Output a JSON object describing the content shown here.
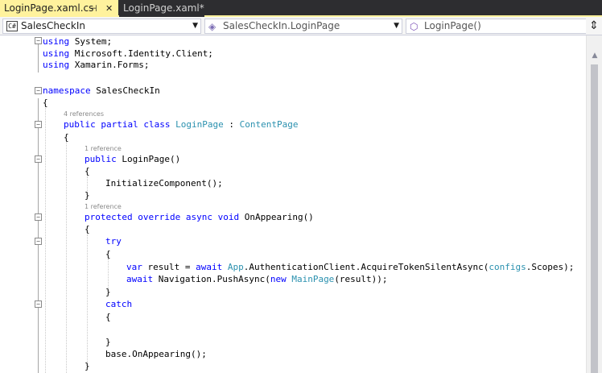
{
  "tabs": [
    {
      "label": "LoginPage.xaml.cs",
      "active": true,
      "pin_icon": "pin-icon",
      "close_icon": "close-icon"
    },
    {
      "label": "LoginPage.xaml*",
      "active": false
    }
  ],
  "navbar": {
    "project": {
      "icon": "csharp-project-icon",
      "icon_text": "C#",
      "label": "SalesCheckIn"
    },
    "type": {
      "icon": "class-icon",
      "label": "SalesCheckIn.LoginPage"
    },
    "member": {
      "icon": "method-icon",
      "label": "LoginPage()"
    }
  },
  "code": {
    "l1": {
      "kw": "using",
      "rest": " System;"
    },
    "l2": {
      "kw": "using",
      "rest": " Microsoft.Identity.Client;"
    },
    "l3": {
      "kw": "using",
      "rest": " Xamarin.Forms;"
    },
    "l5": {
      "kw": "namespace",
      "rest": " SalesCheckIn"
    },
    "l6": {
      "text": "{"
    },
    "lens1": "4 references",
    "l7": {
      "kw1": "public",
      "sp1": " ",
      "kw2": "partial",
      "sp2": " ",
      "kw3": "class",
      "sp3": " ",
      "type": "LoginPage",
      "sep": " : ",
      "base": "ContentPage"
    },
    "l8": {
      "text": "{"
    },
    "lens2": "1 reference",
    "l9": {
      "kw": "public",
      "rest": " LoginPage()"
    },
    "l10": {
      "text": "{"
    },
    "l11": {
      "text": "InitializeComponent();"
    },
    "l12": {
      "text": "}"
    },
    "lens3": "1 reference",
    "l13": {
      "kw1": "protected",
      "sp1": " ",
      "kw2": "override",
      "sp2": " ",
      "kw3": "async",
      "sp3": " ",
      "kw4": "void",
      "rest": " OnAppearing()"
    },
    "l14": {
      "text": "{"
    },
    "l15": {
      "kw": "try"
    },
    "l16": {
      "text": "{"
    },
    "l17": {
      "kw1": "var",
      "p1": " result = ",
      "kw2": "await",
      "sp": " ",
      "type1": "App",
      "p2": ".AuthenticationClient.AcquireTokenSilentAsync(",
      "type2": "configs",
      "p3": ".Scopes);"
    },
    "l18": {
      "kw1": "await",
      "p1": " Navigation.PushAsync(",
      "kw2": "new",
      "sp": " ",
      "type": "MainPage",
      "p2": "(result));"
    },
    "l19": {
      "text": "}"
    },
    "l20": {
      "kw": "catch"
    },
    "l21": {
      "text": "{"
    },
    "l22": {
      "text": ""
    },
    "l23": {
      "text": "}"
    },
    "l24": {
      "text": "base.OnAppearing();"
    },
    "l25": {
      "text": "}"
    }
  },
  "colors": {
    "keyword": "#0000ff",
    "type": "#2b91af",
    "tab_active": "#fff29d",
    "tab_strip": "#2d2d30"
  },
  "scrollbar": {
    "up_icon": "scroll-up-icon",
    "split_icon": "split-view-icon"
  }
}
